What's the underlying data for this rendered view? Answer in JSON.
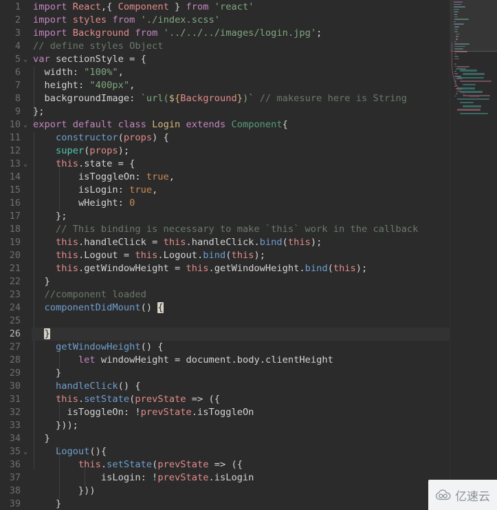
{
  "editor": {
    "theme_bg": "#2b2b2b",
    "current_line_bg": "#323232",
    "active_line": 26,
    "first_visible_line": 1,
    "last_visible_line": 39,
    "colors": {
      "keyword": "#c586c0",
      "class_ref": "#e48b8b",
      "string": "#7fa87f",
      "comment": "#6a7a6a",
      "function": "#6f9fd0",
      "teal": "#4ec9b0",
      "yellow": "#d7ba7d",
      "green_type": "#569e78",
      "number": "#c88b55",
      "plain": "#d4d4d4",
      "line_number": "#6d6f70",
      "bracket_match_bg": "#d7d2c8"
    }
  },
  "gutter": {
    "line_numbers": [
      "1",
      "2",
      "3",
      "4",
      "5",
      "6",
      "7",
      "8",
      "9",
      "10",
      "11",
      "12",
      "13",
      "14",
      "15",
      "16",
      "17",
      "18",
      "19",
      "20",
      "21",
      "22",
      "23",
      "24",
      "25",
      "26",
      "27",
      "28",
      "29",
      "30",
      "31",
      "32",
      "33",
      "34",
      "35",
      "36",
      "37",
      "38",
      "39"
    ],
    "fold_markers_on_lines": [
      5,
      10,
      13,
      35
    ],
    "fold_glyph": "⌄"
  },
  "code": {
    "language": "javascript",
    "file_kind": "React component",
    "lines": [
      {
        "n": 1,
        "text": "import React,{ Component } from 'react'"
      },
      {
        "n": 2,
        "text": "import styles from './index.scss'"
      },
      {
        "n": 3,
        "text": "import Background from '../../../images/login.jpg';"
      },
      {
        "n": 4,
        "text": "// define styles Object"
      },
      {
        "n": 5,
        "text": "var sectionStyle = {"
      },
      {
        "n": 6,
        "text": "  width: \"100%\","
      },
      {
        "n": 7,
        "text": "  height: \"400px\","
      },
      {
        "n": 8,
        "text": "  backgroundImage: `url(${Background})` // makesure here is String"
      },
      {
        "n": 9,
        "text": "};"
      },
      {
        "n": 10,
        "text": "export default class Login extends Component{"
      },
      {
        "n": 11,
        "text": "    constructor(props) {"
      },
      {
        "n": 12,
        "text": "    super(props);"
      },
      {
        "n": 13,
        "text": "    this.state = {"
      },
      {
        "n": 14,
        "text": "        isToggleOn: true,"
      },
      {
        "n": 15,
        "text": "        isLogin: true,"
      },
      {
        "n": 16,
        "text": "        wHeight: 0"
      },
      {
        "n": 17,
        "text": "    };"
      },
      {
        "n": 18,
        "text": "    // This binding is necessary to make `this` work in the callback"
      },
      {
        "n": 19,
        "text": "    this.handleClick = this.handleClick.bind(this);"
      },
      {
        "n": 20,
        "text": "    this.Logout = this.Logout.bind(this);"
      },
      {
        "n": 21,
        "text": "    this.getWindowHeight = this.getWindowHeight.bind(this);"
      },
      {
        "n": 22,
        "text": "  }"
      },
      {
        "n": 23,
        "text": "  //component loaded"
      },
      {
        "n": 24,
        "text": "  componentDidMount() {"
      },
      {
        "n": 25,
        "text": ""
      },
      {
        "n": 26,
        "text": "  }"
      },
      {
        "n": 27,
        "text": "    getWindowHeight() {"
      },
      {
        "n": 28,
        "text": "        let windowHeight = document.body.clientHeight"
      },
      {
        "n": 29,
        "text": "    }"
      },
      {
        "n": 30,
        "text": "    handleClick() {"
      },
      {
        "n": 31,
        "text": "    this.setState(prevState => ({"
      },
      {
        "n": 32,
        "text": "      isToggleOn: !prevState.isToggleOn"
      },
      {
        "n": 33,
        "text": "    }));"
      },
      {
        "n": 34,
        "text": "  }"
      },
      {
        "n": 35,
        "text": "    Logout(){"
      },
      {
        "n": 36,
        "text": "        this.setState(prevState => ({"
      },
      {
        "n": 37,
        "text": "            isLogin: !prevState.isLogin"
      },
      {
        "n": 38,
        "text": "        }))"
      },
      {
        "n": 39,
        "text": "    }"
      }
    ]
  },
  "minimap": {
    "slider_top": 0,
    "slider_height": 75,
    "visible": true
  },
  "watermark": {
    "text": "亿速云",
    "icon": "cloud-icon"
  }
}
